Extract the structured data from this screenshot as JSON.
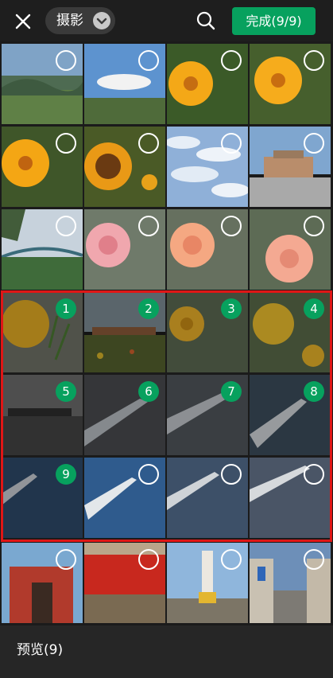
{
  "header": {
    "album_label": "摄影",
    "done_label": "完成(9/9)"
  },
  "photos": [
    {
      "id": "p1",
      "subject": "mountain-landscape",
      "selected": false
    },
    {
      "id": "p2",
      "subject": "sky-with-clouds",
      "selected": false
    },
    {
      "id": "p3",
      "subject": "yellow-flower",
      "selected": false
    },
    {
      "id": "p4",
      "subject": "yellow-flower",
      "selected": false
    },
    {
      "id": "p5",
      "subject": "yellow-flower",
      "selected": false
    },
    {
      "id": "p6",
      "subject": "sunflower",
      "selected": false
    },
    {
      "id": "p7",
      "subject": "cloudy-sky",
      "selected": false
    },
    {
      "id": "p8",
      "subject": "building-square",
      "selected": false
    },
    {
      "id": "p9",
      "subject": "bridge-and-trees",
      "selected": false
    },
    {
      "id": "p10",
      "subject": "pink-rose",
      "selected": false
    },
    {
      "id": "p11",
      "subject": "peach-rose",
      "selected": false
    },
    {
      "id": "p12",
      "subject": "peach-rose",
      "selected": false
    },
    {
      "id": "p13",
      "subject": "yellow-flower",
      "selected": true,
      "number": "1"
    },
    {
      "id": "p14",
      "subject": "garden-field",
      "selected": true,
      "number": "2"
    },
    {
      "id": "p15",
      "subject": "yellow-rose",
      "selected": true,
      "number": "3"
    },
    {
      "id": "p16",
      "subject": "yellow-rose",
      "selected": true,
      "number": "4"
    },
    {
      "id": "p17",
      "subject": "city-skyline-water",
      "selected": true,
      "number": "5"
    },
    {
      "id": "p18",
      "subject": "airplane-wing",
      "selected": true,
      "number": "6"
    },
    {
      "id": "p19",
      "subject": "airplane-wing",
      "selected": true,
      "number": "7"
    },
    {
      "id": "p20",
      "subject": "airplane-wing",
      "selected": true,
      "number": "8"
    },
    {
      "id": "p21",
      "subject": "airplane-wing",
      "selected": true,
      "number": "9"
    },
    {
      "id": "p22",
      "subject": "airplane-wing",
      "selected": false
    },
    {
      "id": "p23",
      "subject": "airplane-wing",
      "selected": false
    },
    {
      "id": "p24",
      "subject": "airplane-wing",
      "selected": false
    },
    {
      "id": "p25",
      "subject": "gate",
      "selected": false
    },
    {
      "id": "p26",
      "subject": "red-banner",
      "selected": false
    },
    {
      "id": "p27",
      "subject": "statue",
      "selected": false
    },
    {
      "id": "p28",
      "subject": "street",
      "selected": false
    }
  ],
  "footer": {
    "preview_label": "预览(9)"
  },
  "colors": {
    "accent": "#07a15e",
    "highlight": "#e01616"
  },
  "icons": {
    "close": "close-icon",
    "dropdown": "chevron-down-icon",
    "search": "search-icon"
  }
}
